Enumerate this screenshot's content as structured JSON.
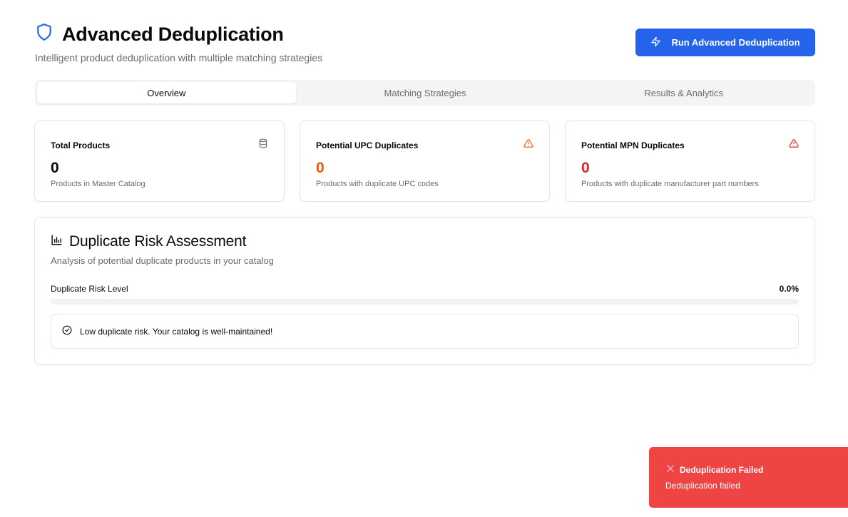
{
  "header": {
    "title": "Advanced Deduplication",
    "subtitle": "Intelligent product deduplication with multiple matching strategies",
    "run_button_label": "Run Advanced Deduplication",
    "accent_color": "#2563eb"
  },
  "tabs": [
    {
      "label": "Overview",
      "active": true
    },
    {
      "label": "Matching Strategies",
      "active": false
    },
    {
      "label": "Results & Analytics",
      "active": false
    }
  ],
  "stats": [
    {
      "label": "Total Products",
      "value": "0",
      "description": "Products in Master Catalog",
      "icon": "database-icon",
      "value_color": "#0a0a0a"
    },
    {
      "label": "Potential UPC Duplicates",
      "value": "0",
      "description": "Products with duplicate UPC codes",
      "icon": "warning-triangle-icon",
      "value_color": "#ea580c"
    },
    {
      "label": "Potential MPN Duplicates",
      "value": "0",
      "description": "Products with duplicate manufacturer part numbers",
      "icon": "alert-triangle-icon",
      "value_color": "#dc2626"
    }
  ],
  "risk": {
    "title": "Duplicate Risk Assessment",
    "subtitle": "Analysis of potential duplicate products in your catalog",
    "level_label": "Duplicate Risk Level",
    "level_value": "0.0%",
    "level_fraction": 0.0,
    "alert_text": "Low duplicate risk. Your catalog is well-maintained!"
  },
  "toast": {
    "title": "Deduplication Failed",
    "description": "Deduplication failed",
    "color": "#ef4444"
  }
}
